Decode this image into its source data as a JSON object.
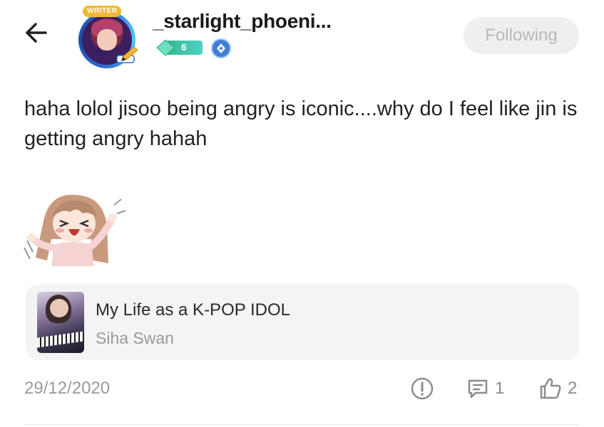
{
  "header": {
    "back_icon": "arrow-left-icon",
    "avatar_tag": "WRITER",
    "username": "_starlight_phoeni...",
    "level": "6",
    "follow_label": "Following"
  },
  "post": {
    "text": "haha lolol jisoo being angry is iconic....why do I feel like jin is getting angry hahah",
    "sticker": "laughing-anime-girl-sticker"
  },
  "book": {
    "title": "My Life as a K-POP IDOL",
    "author": "Siha Swan"
  },
  "footer": {
    "date": "29/12/2020",
    "report_icon": "exclamation-circle-icon",
    "comment_icon": "comment-icon",
    "comment_count": "1",
    "like_icon": "thumbs-up-icon",
    "like_count": "2"
  },
  "colors": {
    "follow_bg": "#efefef",
    "follow_text": "#b9b9b9",
    "writer_tag": "#f2b733",
    "level_badge": "#3ec7a8",
    "verify_badge": "#3f7fd8",
    "card_bg": "#f4f4f4",
    "muted_text": "#9a9a9a"
  }
}
